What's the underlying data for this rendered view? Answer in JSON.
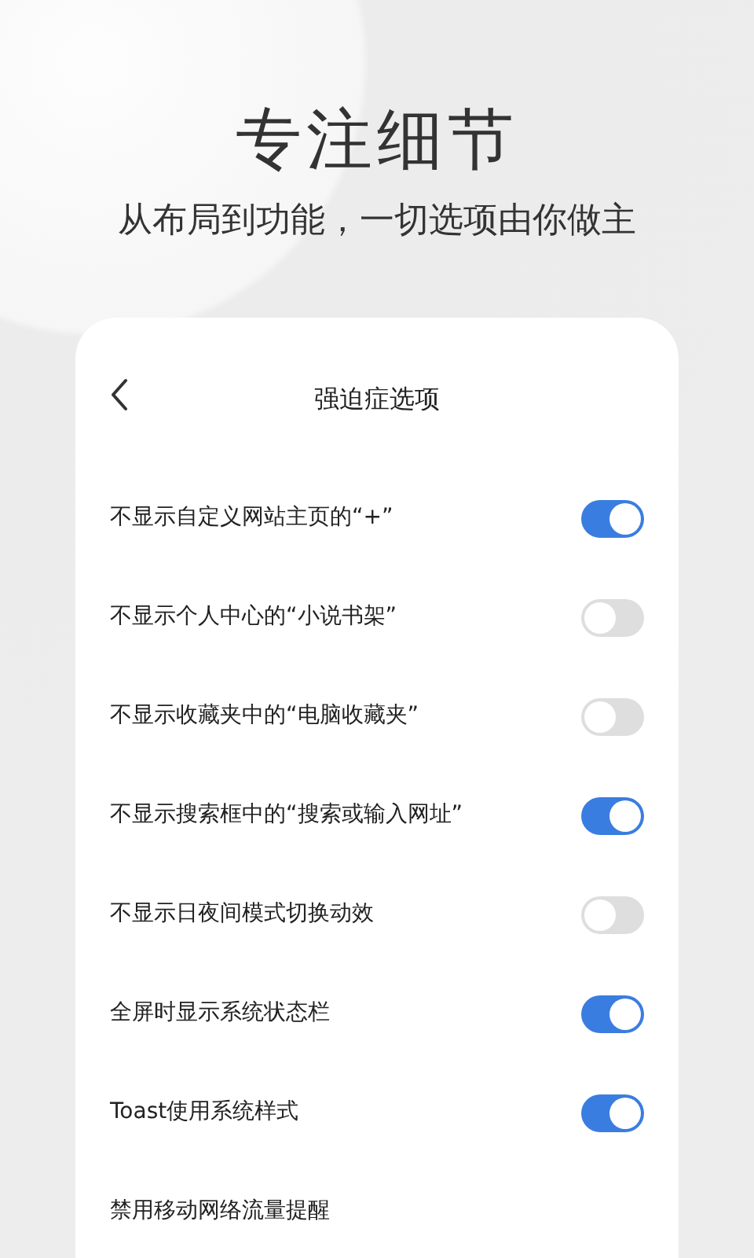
{
  "headline": "专注细节",
  "subtitle": "从布局到功能，一切选项由你做主",
  "screen": {
    "title": "强迫症选项",
    "options": [
      {
        "label": "不显示自定义网站主页的“+”",
        "on": true
      },
      {
        "label": "不显示个人中心的“小说书架”",
        "on": false
      },
      {
        "label": "不显示收藏夹中的“电脑收藏夹”",
        "on": false
      },
      {
        "label": "不显示搜索框中的“搜索或输入网址”",
        "on": true
      },
      {
        "label": "不显示日夜间模式切换动效",
        "on": false
      },
      {
        "label": "全屏时显示系统状态栏",
        "on": true
      },
      {
        "label": "Toast使用系统样式",
        "on": true
      },
      {
        "label": "禁用移动网络流量提醒"
      }
    ]
  }
}
